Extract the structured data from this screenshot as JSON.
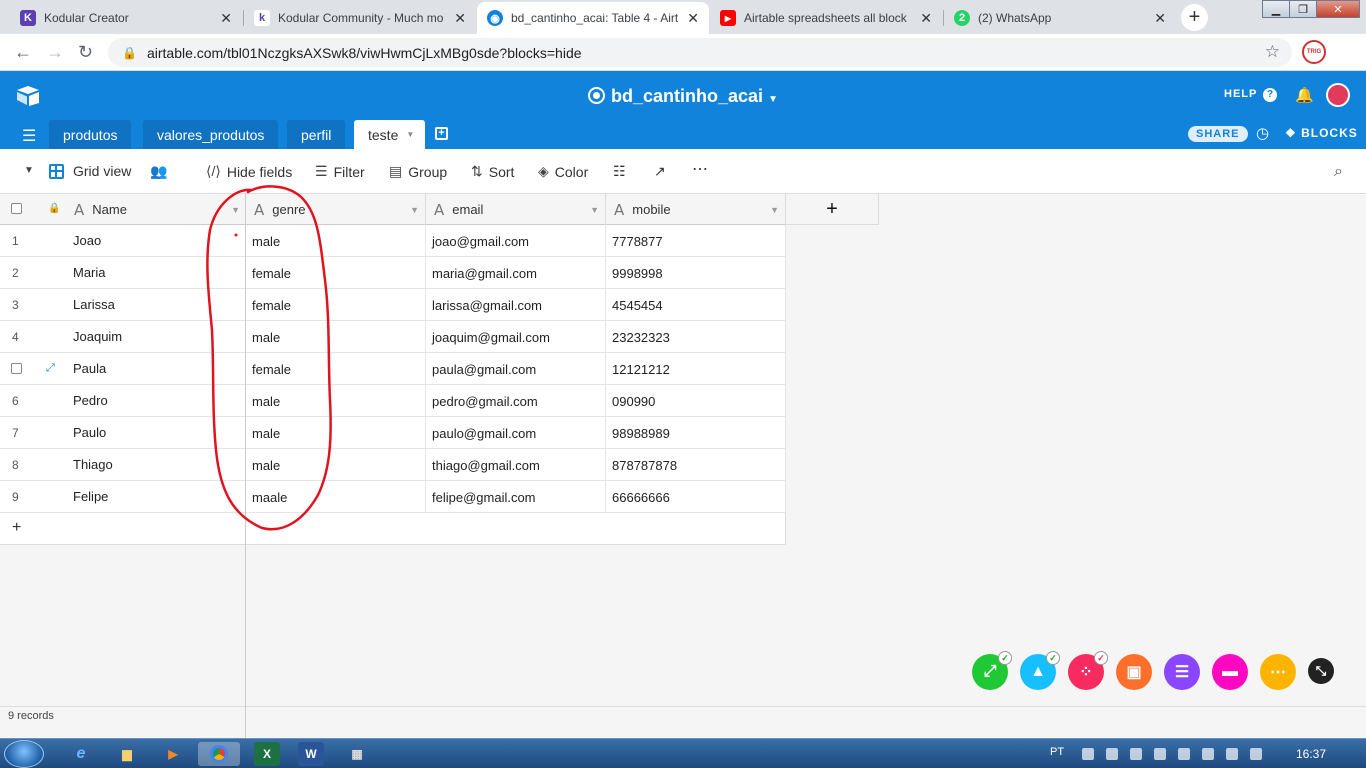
{
  "browser": {
    "tabs": [
      {
        "title": "Kodular Creator",
        "favicon": "K",
        "color": "#5b3fb0"
      },
      {
        "title": "Kodular Community - Much mo",
        "favicon": "k",
        "color": "#ffffff"
      },
      {
        "title": "bd_cantinho_acai: Table 4 - Airt",
        "favicon": "",
        "color": "#1283da"
      },
      {
        "title": "Airtable spreadsheets all block",
        "favicon": "▶",
        "color": "#ff0000"
      },
      {
        "title": "(2) WhatsApp",
        "favicon": "2",
        "color": "#25d366"
      }
    ],
    "url": "airtable.com/tbl01NczgksAXSwk8/viwHwmCjLxMBg0sde?blocks=hide"
  },
  "app": {
    "base_name": "bd_cantinho_acai",
    "help": "HELP",
    "share": "SHARE",
    "blocks": "BLOCKS",
    "tables": [
      "produtos",
      "valores_produtos",
      "perfil",
      "teste"
    ],
    "active_table": "teste"
  },
  "viewbar": {
    "view_name": "Grid view",
    "hide_fields": "Hide fields",
    "filter": "Filter",
    "group": "Group",
    "sort": "Sort",
    "color": "Color"
  },
  "grid": {
    "columns": [
      "Name",
      "genre",
      "email",
      "mobile"
    ],
    "rows": [
      {
        "n": "1",
        "name": "Joao",
        "genre": "male",
        "email": "joao@gmail.com",
        "mobile": "7778877"
      },
      {
        "n": "2",
        "name": "Maria",
        "genre": "female",
        "email": "maria@gmail.com",
        "mobile": "9998998"
      },
      {
        "n": "3",
        "name": "Larissa",
        "genre": "female",
        "email": "larissa@gmail.com",
        "mobile": "4545454"
      },
      {
        "n": "4",
        "name": "Joaquim",
        "genre": "male",
        "email": "joaquim@gmail.com",
        "mobile": "23232323"
      },
      {
        "n": "",
        "name": "Paula",
        "genre": "female",
        "email": "paula@gmail.com",
        "mobile": "12121212"
      },
      {
        "n": "6",
        "name": "Pedro",
        "genre": "male",
        "email": "pedro@gmail.com",
        "mobile": "090990"
      },
      {
        "n": "7",
        "name": "Paulo",
        "genre": "male",
        "email": "paulo@gmail.com",
        "mobile": "98988989"
      },
      {
        "n": "8",
        "name": "Thiago",
        "genre": "male",
        "email": "thiago@gmail.com",
        "mobile": "878787878"
      },
      {
        "n": "9",
        "name": "Felipe",
        "genre": "maale",
        "email": "felipe@gmail.com",
        "mobile": "66666666"
      }
    ],
    "record_count": "9 records"
  },
  "taskbar": {
    "lang": "PT",
    "clock": "16:37"
  }
}
